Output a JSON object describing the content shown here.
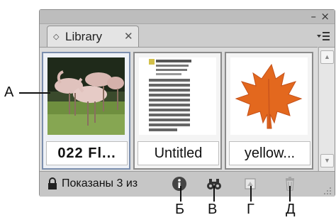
{
  "panel": {
    "tab": {
      "label": "Library"
    },
    "window_controls": {
      "minimize": "–",
      "close": "×"
    },
    "items": [
      {
        "caption": "022 Fl...",
        "thumbnail": "flamingos-photo"
      },
      {
        "caption": "Untitled",
        "thumbnail": "text-document"
      },
      {
        "caption": "yellow...",
        "thumbnail": "maple-leaf"
      }
    ],
    "status": {
      "text": "Показаны 3 из"
    },
    "status_icons": [
      "lock-icon",
      "info-icon",
      "binoculars-icon",
      "new-item-icon",
      "trash-icon"
    ]
  },
  "callouts": {
    "a": "А",
    "b": "Б",
    "v": "В",
    "g": "Г",
    "d": "Д"
  },
  "colors": {
    "panel_bg": "#c9c9c9",
    "selection_border": "#7b8ead",
    "leaf": "#e3681e"
  }
}
